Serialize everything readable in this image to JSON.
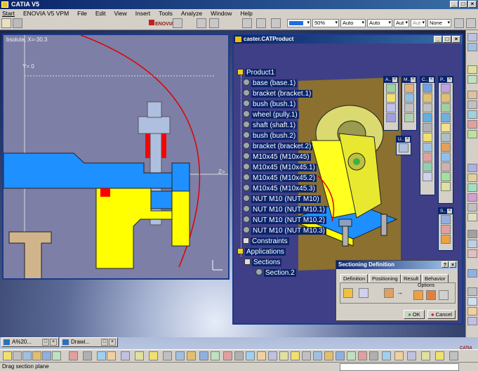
{
  "app": {
    "title": "CATIA V5"
  },
  "menu": [
    "Start",
    "ENOVIA V5 VPM",
    "File",
    "Edit",
    "View",
    "Insert",
    "Tools",
    "Analyze",
    "Window",
    "Help"
  ],
  "toolbar": {
    "enovia_label": "ENOVIA",
    "zoom_value": "50%",
    "combo1": "Auto",
    "combo2": "Auto",
    "combo3": "Aut",
    "combo4": "Aut",
    "combo5": "None"
  },
  "drawing_window": {
    "readout": "bsolute, X=-30.3",
    "y_axis_label": "Y=  0",
    "z_axis_label": "Z="
  },
  "product_window": {
    "title": "caster.CATProduct"
  },
  "tree": {
    "root": "Product1",
    "parts": [
      "base (base.1)",
      "bracket (bracket.1)",
      "bush (bush.1)",
      "wheel (pully.1)",
      "shaft (shaft.1)",
      "bush (bush.2)",
      "bracket (bracket.2)",
      "M10x45 (M10x45)",
      "M10x45 (M10x45.1)",
      "M10x45 (M10x45.2)",
      "M10x45 (M10x45.3)",
      "NUT M10 (NUT M10)",
      "NUT M10 (NUT M10.1)",
      "NUT M10 (NUT M10.2)",
      "NUT M10 (NUT M10.3)"
    ],
    "constraints": "Constraints",
    "applications": "Applications",
    "sections": "Sections",
    "section_item": "Section.2"
  },
  "floating_toolbars": [
    "A..",
    "M..",
    "C..",
    "P..",
    "U..",
    "S.."
  ],
  "section_dialog": {
    "title": "Sectioning Definition",
    "tabs": [
      "Definition",
      "Positioning",
      "Result",
      "Behavior"
    ],
    "options_label": "Options",
    "ok_label": "OK",
    "cancel_label": "Cancel"
  },
  "taskbar": [
    {
      "label": "A%20..."
    },
    {
      "label": "Drawi..."
    }
  ],
  "status": {
    "text": "Drag section plane"
  },
  "catia_logo": "CATIA",
  "colors": {
    "titlebar": "#0a246a",
    "selection": "#0a246a",
    "part_yellow": "#ffff00",
    "part_blue": "#1e90ff",
    "part_gray": "#a5b9dc",
    "section_red": "#ff0000"
  }
}
